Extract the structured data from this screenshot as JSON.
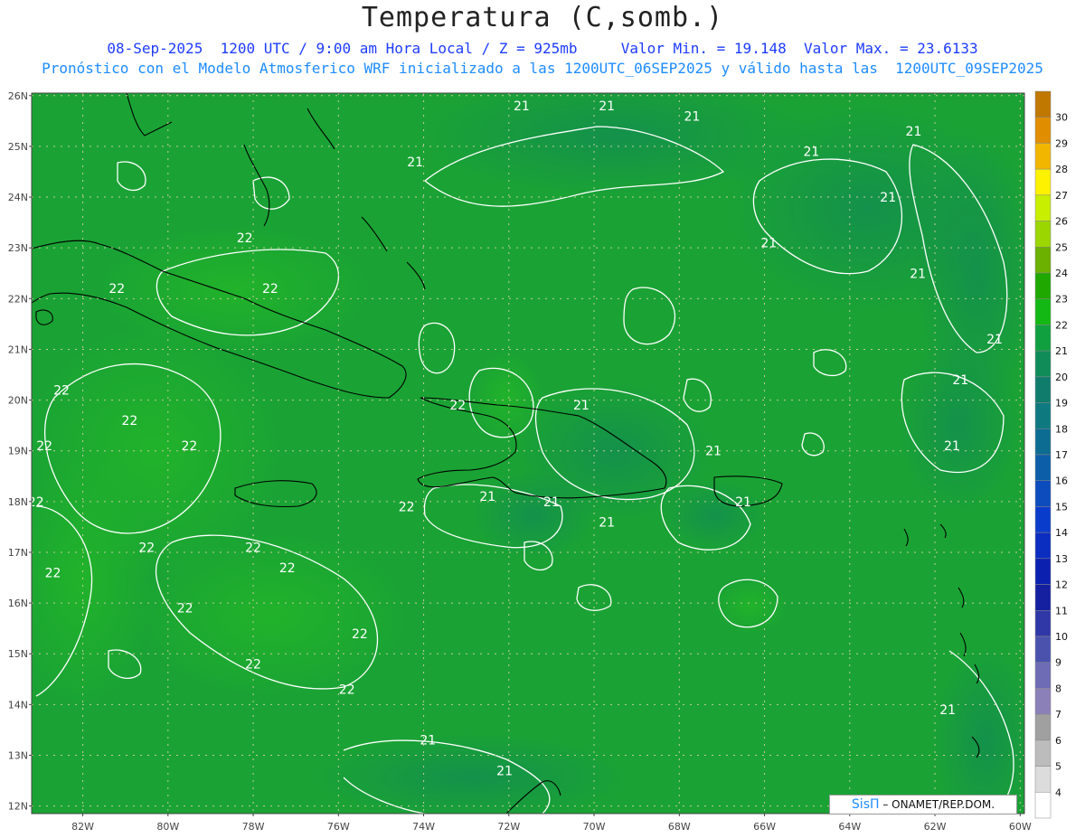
{
  "header": {
    "title": "Temperatura (C,somb.)",
    "subtitle_line1": "08-Sep-2025  1200 UTC / 9:00 am Hora Local / Z = 925mb     Valor Min. = 19.148  Valor Max. = 23.6133",
    "subtitle_line2": "Pronóstico con el Modelo Atmosferico WRF inicializado a las 1200UTC_06SEP2025 y válido hasta las  1200UTC_09SEP2025"
  },
  "map": {
    "lat_labels": [
      "26N",
      "25N",
      "24N",
      "23N",
      "22N",
      "21N",
      "20N",
      "19N",
      "18N",
      "17N",
      "16N",
      "15N",
      "14N",
      "13N",
      "12N"
    ],
    "lon_labels": [
      "82W",
      "80W",
      "78W",
      "76W",
      "74W",
      "72W",
      "70W",
      "68W",
      "66W",
      "64W",
      "62W",
      "60W"
    ],
    "colors": {
      "field_main": "#1aa334",
      "field_warm": "#22b42a",
      "field_cool": "#138f4e",
      "contour": "#ffffff",
      "coast": "#000000",
      "grid": "#c8c8a0"
    },
    "contour_labels": [
      {
        "text": "21",
        "lon": -69.7,
        "lat": 25.8
      },
      {
        "text": "21",
        "lon": -71.7,
        "lat": 25.8
      },
      {
        "text": "21",
        "lon": -67.7,
        "lat": 25.6
      },
      {
        "text": "21",
        "lon": -62.5,
        "lat": 25.3
      },
      {
        "text": "21",
        "lon": -64.9,
        "lat": 24.9
      },
      {
        "text": "21",
        "lon": -74.2,
        "lat": 24.7
      },
      {
        "text": "21",
        "lon": -63.1,
        "lat": 24.0
      },
      {
        "text": "21",
        "lon": -65.9,
        "lat": 23.1
      },
      {
        "text": "21",
        "lon": -62.4,
        "lat": 22.5
      },
      {
        "text": "21",
        "lon": -60.6,
        "lat": 21.2
      },
      {
        "text": "21",
        "lon": -61.4,
        "lat": 20.4
      },
      {
        "text": "21",
        "lon": -70.3,
        "lat": 19.9
      },
      {
        "text": "21",
        "lon": -61.6,
        "lat": 19.1
      },
      {
        "text": "21",
        "lon": -67.2,
        "lat": 19.0
      },
      {
        "text": "21",
        "lon": -72.5,
        "lat": 18.1
      },
      {
        "text": "21",
        "lon": -71.0,
        "lat": 18.0
      },
      {
        "text": "21",
        "lon": -66.5,
        "lat": 18.0
      },
      {
        "text": "21",
        "lon": -69.7,
        "lat": 17.6
      },
      {
        "text": "21",
        "lon": -61.7,
        "lat": 13.9
      },
      {
        "text": "21",
        "lon": -73.9,
        "lat": 13.3
      },
      {
        "text": "21",
        "lon": -72.1,
        "lat": 12.7
      },
      {
        "text": "22",
        "lon": -78.2,
        "lat": 23.2
      },
      {
        "text": "22",
        "lon": -81.2,
        "lat": 22.2
      },
      {
        "text": "22",
        "lon": -77.6,
        "lat": 22.2
      },
      {
        "text": "22",
        "lon": -82.5,
        "lat": 20.2
      },
      {
        "text": "22",
        "lon": -73.2,
        "lat": 19.9
      },
      {
        "text": "22",
        "lon": -80.9,
        "lat": 19.6
      },
      {
        "text": "22",
        "lon": -82.9,
        "lat": 19.1
      },
      {
        "text": "22",
        "lon": -79.5,
        "lat": 19.1
      },
      {
        "text": "22",
        "lon": -83.1,
        "lat": 18.0
      },
      {
        "text": "22",
        "lon": -74.4,
        "lat": 17.9
      },
      {
        "text": "22",
        "lon": -80.5,
        "lat": 17.1
      },
      {
        "text": "22",
        "lon": -78.0,
        "lat": 17.1
      },
      {
        "text": "22",
        "lon": -82.7,
        "lat": 16.6
      },
      {
        "text": "22",
        "lon": -77.2,
        "lat": 16.7
      },
      {
        "text": "22",
        "lon": -79.6,
        "lat": 15.9
      },
      {
        "text": "22",
        "lon": -75.5,
        "lat": 15.4
      },
      {
        "text": "22",
        "lon": -78.0,
        "lat": 14.8
      },
      {
        "text": "22",
        "lon": -75.8,
        "lat": 14.3
      }
    ]
  },
  "colorbar": {
    "labels": [
      "30",
      "29",
      "28",
      "27",
      "26",
      "25",
      "24",
      "23",
      "22",
      "21",
      "20",
      "19",
      "18",
      "17",
      "16",
      "15",
      "14",
      "13",
      "12",
      "11",
      "10",
      "9",
      "8",
      "7",
      "6",
      "5",
      "4"
    ],
    "colors": [
      "#c07800",
      "#e08e00",
      "#f2b500",
      "#fff200",
      "#c8ee00",
      "#9bd600",
      "#6cb000",
      "#1fa800",
      "#14b814",
      "#10a040",
      "#108c58",
      "#107c6c",
      "#0e7a80",
      "#0d6c92",
      "#0c5ea8",
      "#0c4cbc",
      "#0a3ccc",
      "#0b2dc0",
      "#0c20b0",
      "#1420a0",
      "#3038a8",
      "#4a52ae",
      "#6e6cb4",
      "#8c80b8",
      "#a0a0a0",
      "#bcbcbc",
      "#dcdcdc",
      "#ffffff"
    ]
  },
  "credit": {
    "logo": "SisΠ",
    "text": "– ONAMET/REP.DOM."
  }
}
